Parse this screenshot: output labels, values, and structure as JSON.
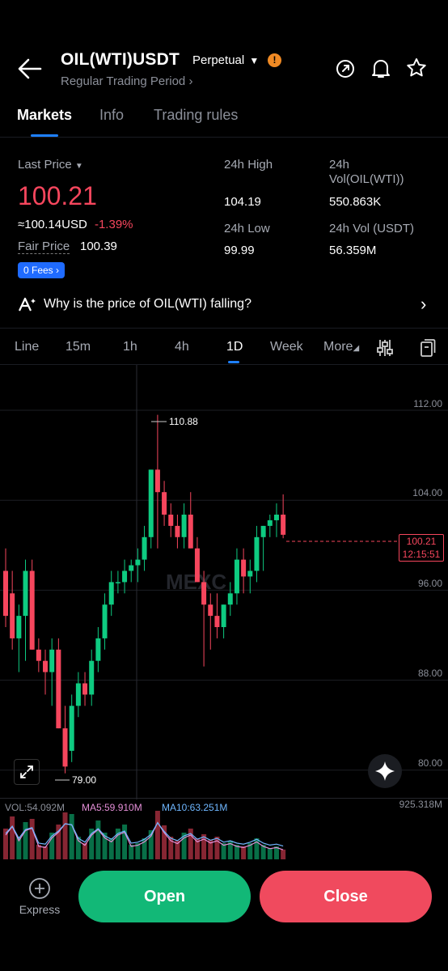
{
  "header": {
    "title": "OIL(WTI)USDT",
    "contract_type": "Perpetual",
    "warning_mark": "!",
    "subtitle": "Regular Trading Period"
  },
  "icons": [
    "back-arrow-icon",
    "share-icon",
    "bell-icon",
    "star-icon",
    "indicator-settings-icon",
    "layout-icon",
    "expand-icon",
    "ai-sparkle-icon",
    "add-circle-icon"
  ],
  "tabs": [
    {
      "label": "Markets",
      "active": true
    },
    {
      "label": "Info",
      "active": false
    },
    {
      "label": "Trading rules",
      "active": false
    }
  ],
  "ticker": {
    "last_price_label": "Last Price",
    "last_price": "100.21",
    "usd_value": "≈100.14",
    "usd_unit": "USD",
    "change": "-1.39%",
    "fair_price_label": "Fair Price",
    "fair_price": "100.39",
    "fees_badge": "0 Fees",
    "high_label": "24h High",
    "high": "104.19",
    "low_label": "24h Low",
    "low": "99.99",
    "vol_base_label_1": "24h",
    "vol_base_label_2": "Vol(OIL(WTI))",
    "vol_base": "550.863K",
    "vol_quote_label": "24h Vol (USDT)",
    "vol_quote": "56.359M"
  },
  "insight": {
    "text": "Why is the price of OIL(WTI) falling?"
  },
  "timeframes": [
    {
      "label": "Line",
      "active": false
    },
    {
      "label": "15m",
      "active": false
    },
    {
      "label": "1h",
      "active": false
    },
    {
      "label": "4h",
      "active": false
    },
    {
      "label": "1D",
      "active": true
    },
    {
      "label": "Week",
      "active": false
    },
    {
      "label": "More",
      "active": false
    }
  ],
  "chart": {
    "y_ticks": [
      "112.00",
      "104.00",
      "96.00",
      "88.00",
      "80.00"
    ],
    "high_marker": "110.88",
    "low_marker": "79.00",
    "current_price": "100.21",
    "countdown": "12:15:51",
    "watermark": "MEXC",
    "volume_scale": "925.318M",
    "vol_label": "VOL:54.092M",
    "ma5_label": "MA5:59.910M",
    "ma10_label": "MA10:63.251M"
  },
  "colors": {
    "up": "#0ecb81",
    "down": "#f6465d",
    "accent": "#1e80ff",
    "background": "#000000"
  },
  "bottom": {
    "express_label": "Express",
    "open_label": "Open",
    "close_label": "Close"
  }
}
